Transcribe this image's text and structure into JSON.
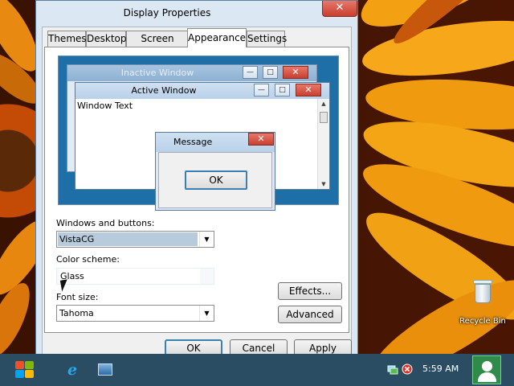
{
  "desktop": {
    "recycle_bin_label": "Recycle Bin",
    "recycle_bin_icon": "recycle-bin-icon"
  },
  "dialog": {
    "title": "Display Properties",
    "close_glyph": "✕",
    "tabs": [
      {
        "label": "Themes",
        "active": false
      },
      {
        "label": "Desktop",
        "active": false
      },
      {
        "label": "Screen Saver",
        "active": false
      },
      {
        "label": "Appearance",
        "active": true
      },
      {
        "label": "Settings",
        "active": false
      }
    ],
    "preview": {
      "inactive_window_title": "Inactive Window",
      "active_window_title": "Active Window",
      "window_text": "Window Text",
      "message_box_title": "Message Box",
      "message_box_ok": "OK",
      "minimize_glyph": "—",
      "maximize_glyph": "□",
      "close_glyph": "✕",
      "scroll_up_glyph": "▲",
      "scroll_down_glyph": "▼"
    },
    "windows_and_buttons": {
      "label": "Windows and buttons:",
      "value": "VistaCG"
    },
    "color_scheme": {
      "label": "Color scheme:",
      "value": "Glass"
    },
    "font_size": {
      "label": "Font size:",
      "value": "Tahoma"
    },
    "dropdown_glyph": "▼",
    "buttons": {
      "effects": "Effects...",
      "advanced": "Advanced",
      "ok": "OK",
      "cancel": "Cancel",
      "apply": "Apply"
    }
  },
  "taskbar": {
    "clock": "5:59 AM",
    "ie_glyph": "e",
    "icons": [
      "windows-start-icon",
      "internet-explorer-icon",
      "display-properties-icon",
      "network-icon",
      "security-alert-icon",
      "user-icon"
    ],
    "colors": {
      "bar": "#2b4d63",
      "accent": "#3c7fb1"
    }
  }
}
